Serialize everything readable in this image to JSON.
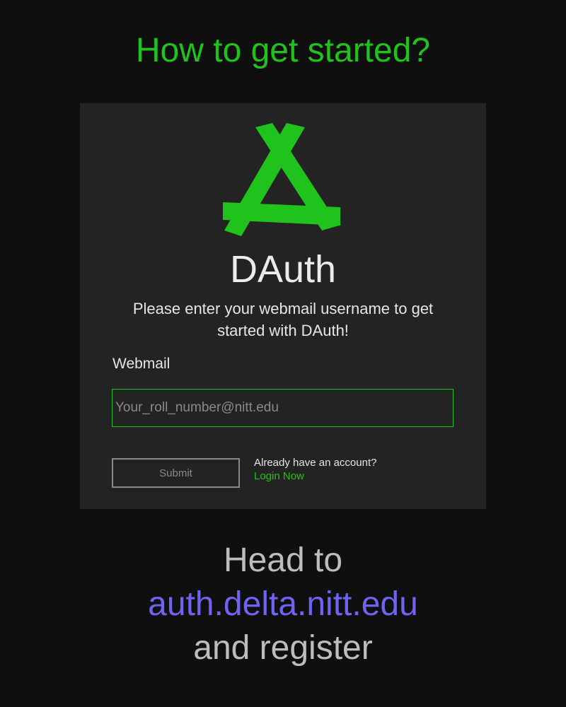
{
  "heading": "How to get started?",
  "dauth_card": {
    "brand": "DAuth",
    "subtitle": "Please enter your webmail username to get started with DAuth!",
    "webmail_label": "Webmail",
    "webmail_placeholder": "Your_roll_number@nitt.edu",
    "submit_label": "Submit",
    "account_question": "Already have an account?",
    "login_link": "Login Now",
    "logo_icon": "dauth-logo-icon"
  },
  "footer": {
    "line1": "Head to",
    "link": "auth.delta.nitt.edu",
    "line3": "and register"
  },
  "colors": {
    "background": "#0f0f0f",
    "card": "#232323",
    "accent_green": "#20c31b",
    "link_purple": "#6f63f2",
    "footer_gray": "#bdbdbd"
  }
}
